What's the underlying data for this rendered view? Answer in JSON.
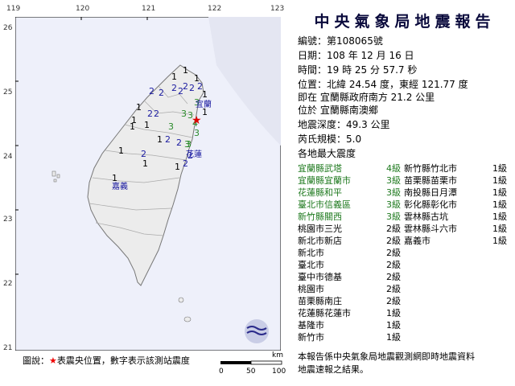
{
  "map": {
    "lon_ticks": [
      "119",
      "120",
      "121",
      "122",
      "123"
    ],
    "lat_ticks": [
      "26",
      "25",
      "24",
      "23",
      "22",
      "21"
    ],
    "place_labels": [
      {
        "text": "宜蘭",
        "color": "#1a1aa0"
      },
      {
        "text": "花蓮",
        "color": "#1a1aa0"
      },
      {
        "text": "嘉義",
        "color": "#1a1aa0"
      }
    ],
    "station_marks": [
      {
        "text": "1",
        "color": "#000"
      },
      {
        "text": "1",
        "color": "#000"
      },
      {
        "text": "1",
        "color": "#000"
      },
      {
        "text": "2",
        "color": "#1a1aa0"
      },
      {
        "text": "2",
        "color": "#1a1aa0"
      },
      {
        "text": "2",
        "color": "#1a1aa0"
      },
      {
        "text": "2",
        "color": "#1a1aa0"
      },
      {
        "text": "2",
        "color": "#1a1aa0"
      },
      {
        "text": "2",
        "color": "#1a1aa0"
      },
      {
        "text": "2",
        "color": "#1a1aa0"
      },
      {
        "text": "2",
        "color": "#1a1aa0"
      },
      {
        "text": "2",
        "color": "#1a1aa0"
      },
      {
        "text": "3",
        "color": "#2a8a2a"
      },
      {
        "text": "3",
        "color": "#2a8a2a"
      },
      {
        "text": "3",
        "color": "#2a8a2a"
      },
      {
        "text": "3",
        "color": "#2a8a2a"
      },
      {
        "text": "4",
        "color": "#2a8a2a"
      },
      {
        "text": "3",
        "color": "#2a8a2a"
      },
      {
        "text": "1",
        "color": "#000"
      },
      {
        "text": "1",
        "color": "#000"
      },
      {
        "text": "1",
        "color": "#000"
      },
      {
        "text": "1",
        "color": "#000"
      },
      {
        "text": "1",
        "color": "#000"
      },
      {
        "text": "2",
        "color": "#1a1aa0"
      },
      {
        "text": "2",
        "color": "#1a1aa0"
      },
      {
        "text": "3",
        "color": "#2a8a2a"
      },
      {
        "text": "1",
        "color": "#000"
      },
      {
        "text": "2",
        "color": "#1a1aa0"
      },
      {
        "text": "2",
        "color": "#1a1aa0"
      },
      {
        "text": "1",
        "color": "#000"
      },
      {
        "text": "2",
        "color": "#1a1aa0"
      },
      {
        "text": "3",
        "color": "#2a8a2a"
      },
      {
        "text": "1",
        "color": "#000"
      },
      {
        "text": "1",
        "color": "#000"
      },
      {
        "text": "1",
        "color": "#000"
      },
      {
        "text": "1",
        "color": "#000"
      }
    ],
    "legend_prefix": "圖說：",
    "legend_star": "★",
    "legend_text": "表震央位置，數字表示該測站震度",
    "scale_unit": "km",
    "scale_ticks": [
      "0",
      "50",
      "100"
    ],
    "sea_color": "#e8eaf8",
    "land_color": "#ececec"
  },
  "report": {
    "title": "中央氣象局地震報告",
    "number_label": "編號：",
    "number": "第108065號",
    "date_label": "日期：",
    "date": "108 年 12 月 16 日",
    "time_label": "時間：",
    "time": "19 時 25 分 57.7 秒",
    "position_label": "位置：",
    "position": "北緯 24.54 度，東經 121.77 度",
    "position_rel": "即在 宜蘭縣政府南方 21.2 公里",
    "position_loc": "位於 宜蘭縣南澳鄉",
    "depth_label": "地震深度：",
    "depth": "49.3 公里",
    "magnitude_label": "芮氏規模：",
    "magnitude": "5.0",
    "intensity_heading": "各地最大震度",
    "intensity_left": [
      {
        "name": "宜蘭縣武塔",
        "level": "4級",
        "green": true
      },
      {
        "name": "宜蘭縣宜蘭市",
        "level": "3級",
        "green": true
      },
      {
        "name": "花蓮縣和平",
        "level": "3級",
        "green": true
      },
      {
        "name": "臺北市信義區",
        "level": "3級",
        "green": true
      },
      {
        "name": "新竹縣關西",
        "level": "3級",
        "green": true
      },
      {
        "name": "桃園市三光",
        "level": "2級",
        "green": false
      },
      {
        "name": "新北市新店",
        "level": "2級",
        "green": false
      },
      {
        "name": "新北市",
        "level": "2級",
        "green": false
      },
      {
        "name": "臺北市",
        "level": "2級",
        "green": false
      },
      {
        "name": "臺中市德基",
        "level": "2級",
        "green": false
      },
      {
        "name": "桃園市",
        "level": "2級",
        "green": false
      },
      {
        "name": "苗栗縣南庄",
        "level": "2級",
        "green": false
      },
      {
        "name": "花蓮縣花蓮市",
        "level": "1級",
        "green": false
      },
      {
        "name": "基隆市",
        "level": "1級",
        "green": false
      },
      {
        "name": "新竹市",
        "level": "1級",
        "green": false
      }
    ],
    "intensity_right": [
      {
        "name": "新竹縣竹北市",
        "level": "1級"
      },
      {
        "name": "苗栗縣苗栗市",
        "level": "1級"
      },
      {
        "name": "南投縣日月潭",
        "level": "1級"
      },
      {
        "name": "彰化縣彰化市",
        "level": "1級"
      },
      {
        "name": "雲林縣古坑",
        "level": "1級"
      },
      {
        "name": "雲林縣斗六市",
        "level": "1級"
      },
      {
        "name": "嘉義市",
        "level": "1級"
      }
    ],
    "footer_line1": "本報告係中央氣象局地震觀測網即時地震資料",
    "footer_line2": "地震速報之結果。"
  },
  "colors": {
    "accent_green": "#1f7a1f",
    "star_red": "#e00000"
  }
}
